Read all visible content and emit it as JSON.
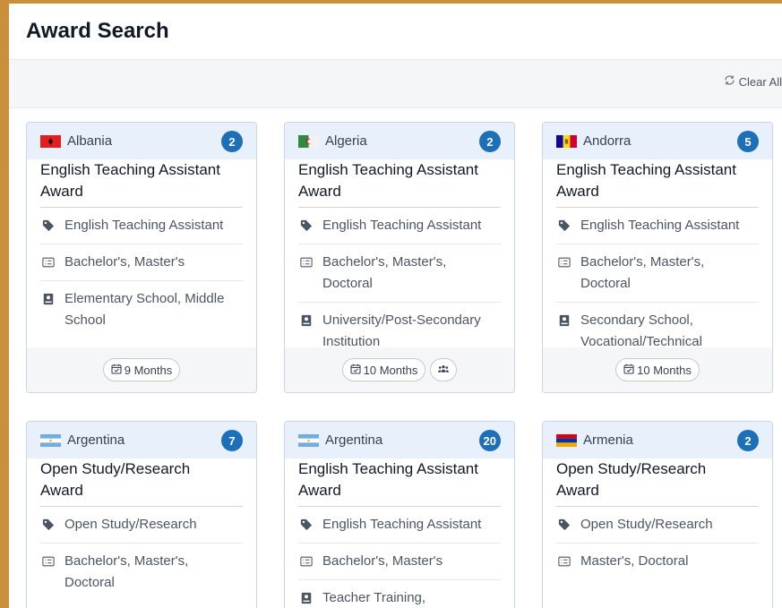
{
  "page": {
    "title": "Award Search"
  },
  "toolbar": {
    "clear_all": "Clear All"
  },
  "cards": [
    {
      "country": "Albania",
      "count": "2",
      "title_line1": "English Teaching Assistant",
      "title_line2": "Award",
      "attrs": [
        {
          "icon": "tag-icon",
          "text": [
            "English Teaching Assistant"
          ]
        },
        {
          "icon": "degree-list-icon",
          "text": [
            "Bachelor's, Master's"
          ]
        },
        {
          "icon": "school-book-icon",
          "text": [
            "Elementary School, Middle",
            "School"
          ]
        }
      ],
      "footer": {
        "duration": "9 Months",
        "group_icon": false
      }
    },
    {
      "country": "Algeria",
      "count": "2",
      "title_line1": "English Teaching Assistant",
      "title_line2": "Award",
      "attrs": [
        {
          "icon": "tag-icon",
          "text": [
            "English Teaching Assistant"
          ]
        },
        {
          "icon": "degree-list-icon",
          "text": [
            "Bachelor's, Master's,",
            "Doctoral"
          ]
        },
        {
          "icon": "school-book-icon",
          "text": [
            "University/Post-Secondary",
            "Institution"
          ]
        }
      ],
      "footer": {
        "duration": "10 Months",
        "group_icon": true
      }
    },
    {
      "country": "Andorra",
      "count": "5",
      "title_line1": "English Teaching Assistant",
      "title_line2": "Award",
      "attrs": [
        {
          "icon": "tag-icon",
          "text": [
            "English Teaching Assistant"
          ]
        },
        {
          "icon": "degree-list-icon",
          "text": [
            "Bachelor's, Master's,",
            "Doctoral"
          ]
        },
        {
          "icon": "school-book-icon",
          "text": [
            "Secondary School,",
            "Vocational/Technical"
          ]
        }
      ],
      "footer": {
        "duration": "10 Months",
        "group_icon": false
      }
    },
    {
      "country": "Argentina",
      "count": "7",
      "title_line1": "Open Study/Research",
      "title_line2": "Award",
      "attrs": [
        {
          "icon": "tag-icon",
          "text": [
            "Open Study/Research"
          ]
        },
        {
          "icon": "degree-list-icon",
          "text": [
            "Bachelor's, Master's,",
            "Doctoral"
          ]
        }
      ],
      "footer": null
    },
    {
      "country": "Argentina",
      "count": "20",
      "title_line1": "English Teaching Assistant",
      "title_line2": "Award",
      "attrs": [
        {
          "icon": "tag-icon",
          "text": [
            "English Teaching Assistant"
          ]
        },
        {
          "icon": "degree-list-icon",
          "text": [
            "Bachelor's, Master's"
          ]
        },
        {
          "icon": "school-book-icon",
          "text": [
            "Teacher Training,"
          ]
        }
      ],
      "footer": null
    },
    {
      "country": "Armenia",
      "count": "2",
      "title_line1": "Open Study/Research",
      "title_line2": "Award",
      "attrs": [
        {
          "icon": "tag-icon",
          "text": [
            "Open Study/Research"
          ]
        },
        {
          "icon": "degree-list-icon",
          "text": [
            "Master's, Doctoral"
          ]
        }
      ],
      "footer": null
    }
  ],
  "colors": {
    "accent_border": "#c98f3b",
    "badge": "#1d6fb8",
    "card_header": "#e8f1fb"
  }
}
